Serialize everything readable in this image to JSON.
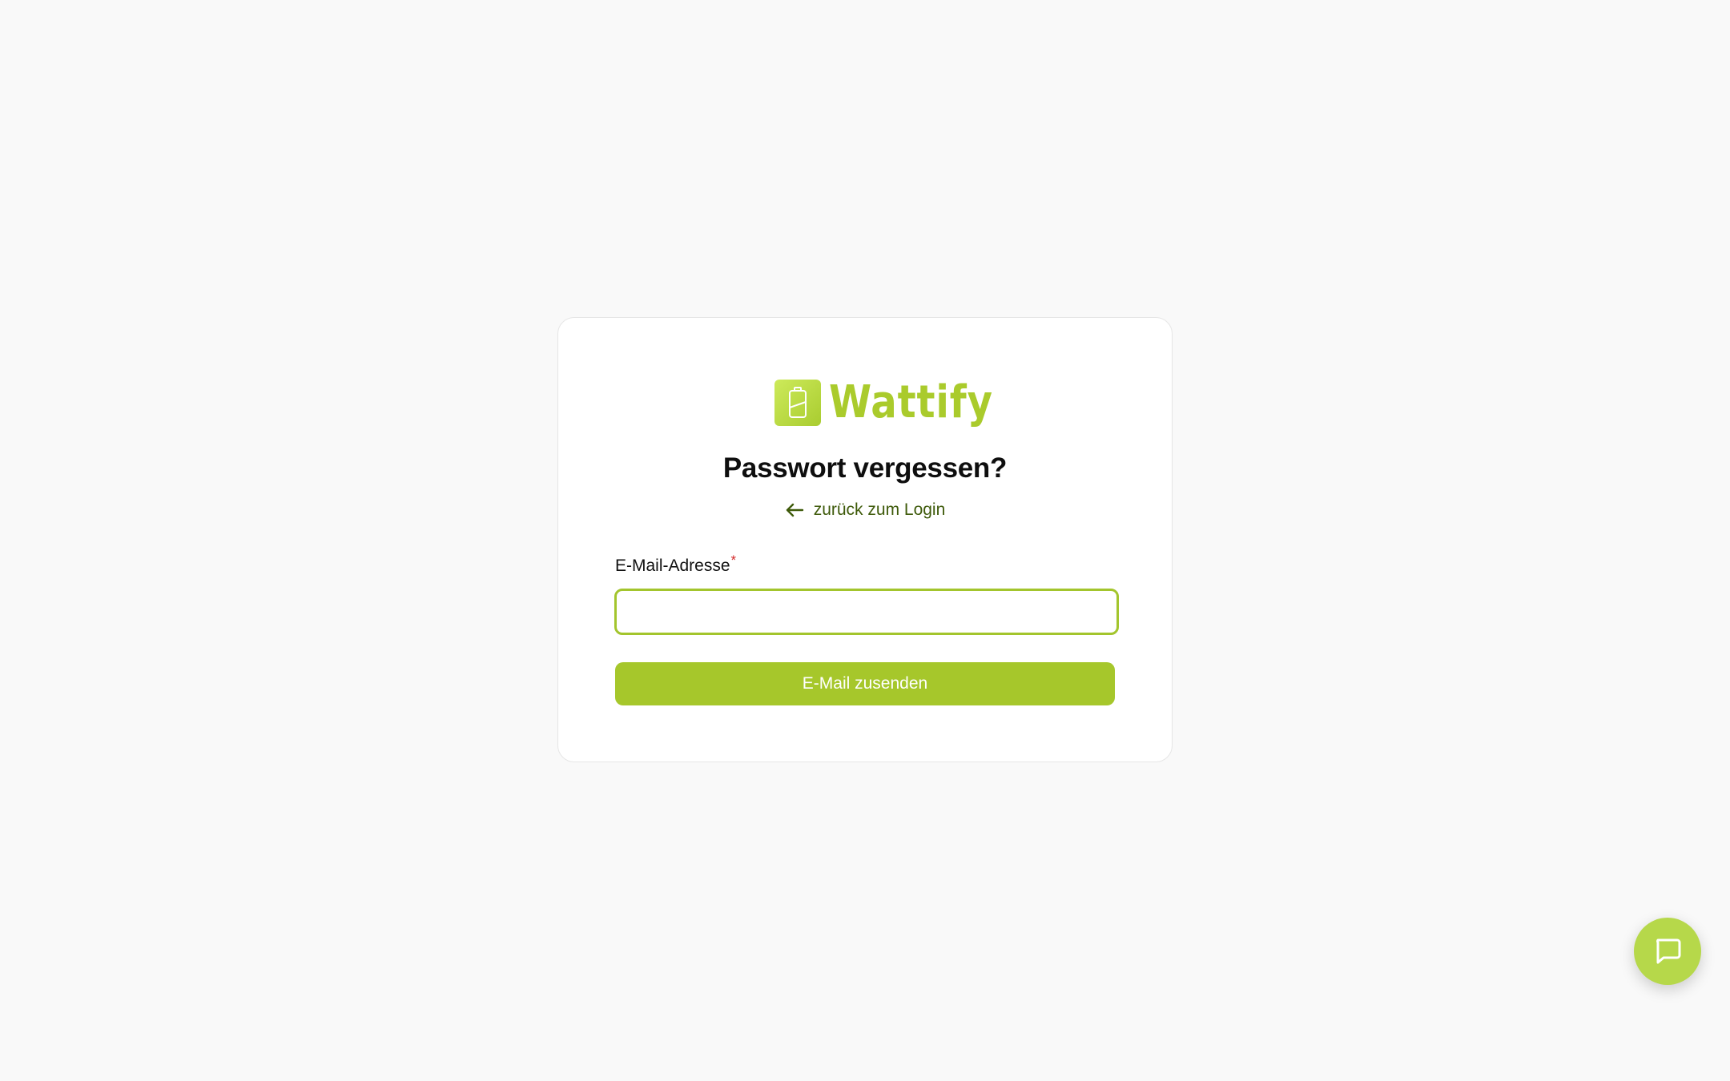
{
  "brand": {
    "name": "Wattify",
    "logo_icon": "battery-icon",
    "accent_color": "#a6c72b"
  },
  "form": {
    "title": "Passwort vergessen?",
    "back_link": {
      "label": "zurück zum Login",
      "icon": "arrow-left-icon"
    },
    "email": {
      "label": "E-Mail-Adresse",
      "required_marker": "*",
      "value": "",
      "placeholder": ""
    },
    "submit_label": "E-Mail zusenden"
  },
  "chat": {
    "icon": "chat-bubble-icon"
  }
}
